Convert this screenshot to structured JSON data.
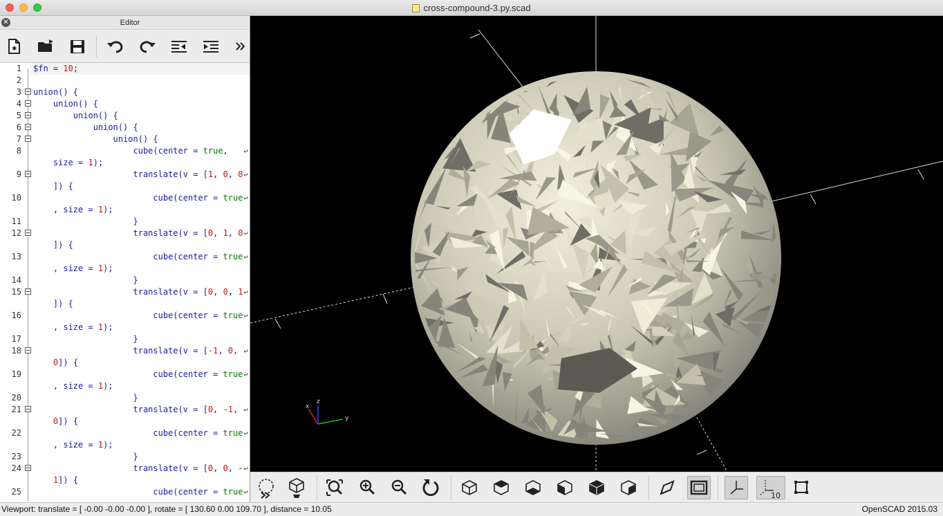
{
  "window": {
    "title": "cross-compound-3.py.scad"
  },
  "editor": {
    "title": "Editor",
    "toolbar": [
      "new-file-icon",
      "open-file-icon",
      "save-icon",
      "undo-icon",
      "redo-icon",
      "unindent-icon",
      "indent-icon",
      "more-icon"
    ]
  },
  "code": {
    "lines": [
      {
        "n": "1",
        "t": "$fn = 10;",
        "fold": false
      },
      {
        "n": "2",
        "t": "",
        "fold": false
      },
      {
        "n": "3",
        "t": "union() {",
        "fold": true
      },
      {
        "n": "4",
        "t": "    union() {",
        "fold": true
      },
      {
        "n": "5",
        "t": "        union() {",
        "fold": true
      },
      {
        "n": "6",
        "t": "            union() {",
        "fold": true
      },
      {
        "n": "7",
        "t": "                union() {",
        "fold": true
      },
      {
        "n": "8",
        "t": "                    cube(center = true,",
        "fold": false,
        "wrap": true
      },
      {
        "n": "",
        "t": "    size = 1);",
        "fold": false
      },
      {
        "n": "9",
        "t": "                    translate(v = [1, 0, 0",
        "fold": true,
        "wrap": true
      },
      {
        "n": "",
        "t": "    ]) {",
        "fold": false
      },
      {
        "n": "10",
        "t": "                        cube(center = true",
        "fold": false,
        "wrap": true
      },
      {
        "n": "",
        "t": "    , size = 1);",
        "fold": false
      },
      {
        "n": "11",
        "t": "                    }",
        "fold": false
      },
      {
        "n": "12",
        "t": "                    translate(v = [0, 1, 0",
        "fold": true,
        "wrap": true
      },
      {
        "n": "",
        "t": "    ]) {",
        "fold": false
      },
      {
        "n": "13",
        "t": "                        cube(center = true",
        "fold": false,
        "wrap": true
      },
      {
        "n": "",
        "t": "    , size = 1);",
        "fold": false
      },
      {
        "n": "14",
        "t": "                    }",
        "fold": false
      },
      {
        "n": "15",
        "t": "                    translate(v = [0, 0, 1",
        "fold": true,
        "wrap": true
      },
      {
        "n": "",
        "t": "    ]) {",
        "fold": false
      },
      {
        "n": "16",
        "t": "                        cube(center = true",
        "fold": false,
        "wrap": true
      },
      {
        "n": "",
        "t": "    , size = 1);",
        "fold": false
      },
      {
        "n": "17",
        "t": "                    }",
        "fold": false
      },
      {
        "n": "18",
        "t": "                    translate(v = [-1, 0, ",
        "fold": true,
        "wrap": true
      },
      {
        "n": "",
        "t": "    0]) {",
        "fold": false
      },
      {
        "n": "19",
        "t": "                        cube(center = true",
        "fold": false,
        "wrap": true
      },
      {
        "n": "",
        "t": "    , size = 1);",
        "fold": false
      },
      {
        "n": "20",
        "t": "                    }",
        "fold": false
      },
      {
        "n": "21",
        "t": "                    translate(v = [0, -1, ",
        "fold": true,
        "wrap": true
      },
      {
        "n": "",
        "t": "    0]) {",
        "fold": false
      },
      {
        "n": "22",
        "t": "                        cube(center = true",
        "fold": false,
        "wrap": true
      },
      {
        "n": "",
        "t": "    , size = 1);",
        "fold": false
      },
      {
        "n": "23",
        "t": "                    }",
        "fold": false
      },
      {
        "n": "24",
        "t": "                    translate(v = [0, 0, -",
        "fold": true,
        "wrap": true
      },
      {
        "n": "",
        "t": "    1]) {",
        "fold": false
      },
      {
        "n": "25",
        "t": "                        cube(center = true",
        "fold": false,
        "wrap": true
      }
    ]
  },
  "viewport": {
    "axis_labels": {
      "x": "x",
      "y": "y",
      "z": "z"
    },
    "toolbar": [
      "preview-icon",
      "render-icon",
      "view-all-icon",
      "zoom-in-icon",
      "zoom-out-icon",
      "reset-view-icon",
      "view-right-icon",
      "view-top-icon",
      "view-bottom-icon",
      "view-left-icon",
      "view-front-icon",
      "view-back-icon",
      "perspective-icon",
      "orthogonal-icon",
      "show-axes-icon",
      "show-scale-icon",
      "show-edges-icon"
    ],
    "scale_label": "10"
  },
  "status": {
    "viewport": "Viewport: translate = [ -0.00 -0.00 -0.00 ], rotate = [ 130.60 0.00 109.70 ], distance = 10.05",
    "version": "OpenSCAD 2015.03"
  }
}
